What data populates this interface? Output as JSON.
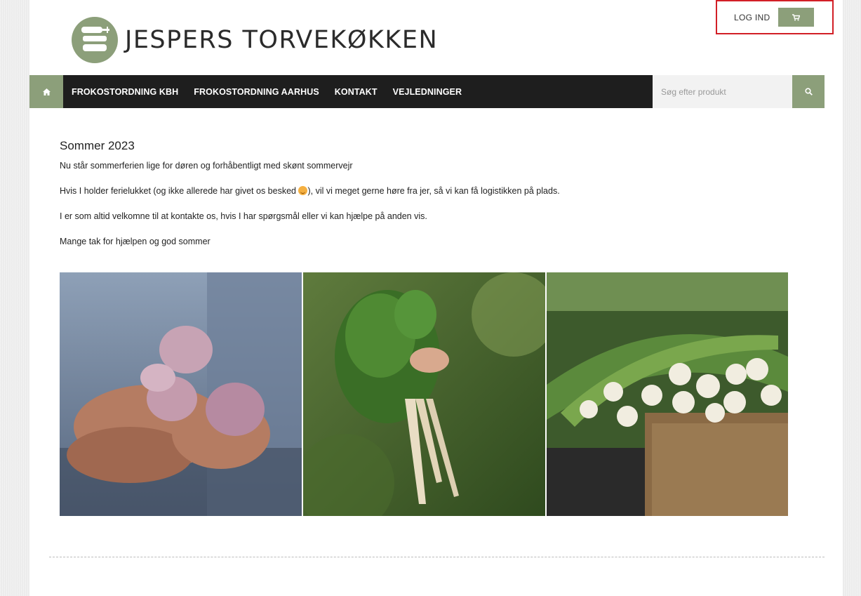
{
  "brand": {
    "name": "JESPERS TORVEKØKKEN"
  },
  "topbar": {
    "login_label": "LOG IND",
    "cart_icon": "cart-icon"
  },
  "nav": {
    "home_icon": "home-icon",
    "items": [
      {
        "label": "FROKOSTORDNING KBH"
      },
      {
        "label": "FROKOSTORDNING AARHUS"
      },
      {
        "label": "KONTAKT"
      },
      {
        "label": "VEJLEDNINGER"
      }
    ],
    "search_placeholder": "Søg efter produkt",
    "search_icon": "search-icon"
  },
  "post": {
    "title": "Sommer 2023",
    "paragraphs": [
      "Nu står sommerferien lige for døren og forhåbentligt med skønt sommervejr",
      "Hvis I holder ferielukket (og ikke allerede har givet os besked",
      "), vil vi meget gerne høre fra jer, så vi kan få logistikken på plads.",
      "I er som altid velkomne til at kontakte os, hvis I har spørgsmål eller vi kan hjælpe på anden vis.",
      "Mange tak for hjælpen og god sommer"
    ]
  },
  "colors": {
    "accent": "#8c9f7a",
    "nav_bg": "#1e1e1e",
    "highlight_border": "#d21f26"
  }
}
